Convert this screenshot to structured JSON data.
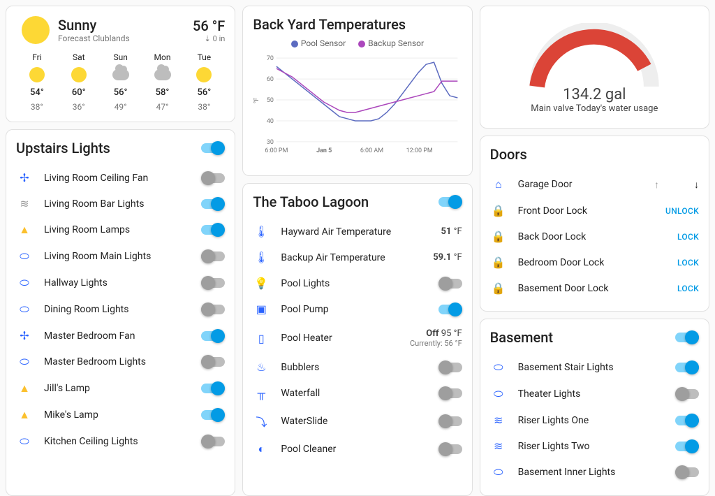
{
  "weather": {
    "condition": "Sunny",
    "location": "Forecast Clublands",
    "temp": "56 °F",
    "precip": "0 in",
    "days": [
      {
        "day": "Fri",
        "icon": "sun",
        "hi": "54°",
        "lo": "38°"
      },
      {
        "day": "Sat",
        "icon": "sun",
        "hi": "60°",
        "lo": "36°"
      },
      {
        "day": "Sun",
        "icon": "cloud",
        "hi": "56°",
        "lo": "49°"
      },
      {
        "day": "Mon",
        "icon": "cloud",
        "hi": "58°",
        "lo": "47°"
      },
      {
        "day": "Tue",
        "icon": "sun",
        "hi": "56°",
        "lo": "38°"
      }
    ]
  },
  "upstairs": {
    "title": "Upstairs Lights",
    "master": true,
    "items": [
      {
        "icon": "fan",
        "label": "Living Room Ceiling Fan",
        "on": false
      },
      {
        "icon": "bar",
        "label": "Living Room Bar Lights",
        "on": true
      },
      {
        "icon": "lamp",
        "label": "Living Room Lamps",
        "on": true
      },
      {
        "icon": "light",
        "label": "Living Room Main Lights",
        "on": false
      },
      {
        "icon": "light",
        "label": "Hallway Lights",
        "on": false
      },
      {
        "icon": "light",
        "label": "Dining Room Lights",
        "on": false
      },
      {
        "icon": "fan",
        "label": "Master Bedroom Fan",
        "on": true
      },
      {
        "icon": "light",
        "label": "Master Bedroom Lights",
        "on": false
      },
      {
        "icon": "lamp",
        "label": "Jill's Lamp",
        "on": true
      },
      {
        "icon": "lamp",
        "label": "Mike's Lamp",
        "on": true
      },
      {
        "icon": "light",
        "label": "Kitchen Ceiling Lights",
        "on": false
      }
    ]
  },
  "chart": {
    "title": "Back Yard Temperatures",
    "legend": [
      "Pool Sensor",
      "Backup Sensor"
    ],
    "ylabel": "°F",
    "xticks": [
      "6:00 PM",
      "Jan 5",
      "6:00 AM",
      "12:00 PM"
    ]
  },
  "chart_data": {
    "type": "line",
    "ylabel": "°F",
    "ylim": [
      30,
      70
    ],
    "xticks": [
      "6:00 PM",
      "Jan 5",
      "6:00 AM",
      "12:00 PM"
    ],
    "series": [
      {
        "name": "Pool Sensor",
        "color": "#5c6bc0",
        "values": [
          66,
          63,
          60,
          57,
          54,
          51,
          48,
          45,
          42,
          41,
          40,
          40,
          40,
          41,
          44,
          48,
          53,
          58,
          63,
          67,
          68,
          58,
          52,
          51
        ]
      },
      {
        "name": "Backup Sensor",
        "color": "#ab47bc",
        "values": [
          65,
          63,
          61,
          58,
          55,
          52,
          49,
          47,
          45,
          44,
          44,
          45,
          46,
          47,
          48,
          49,
          50,
          51,
          52,
          53,
          54,
          59,
          59,
          59
        ]
      }
    ]
  },
  "lagoon": {
    "title": "The Taboo Lagoon",
    "master": true,
    "items": [
      {
        "icon": "therm",
        "label": "Hayward Air Temperature",
        "value": "51 °F"
      },
      {
        "icon": "therm",
        "label": "Backup Air Temperature",
        "value": "59.1 °F"
      },
      {
        "icon": "bulb",
        "label": "Pool Lights",
        "on": false
      },
      {
        "icon": "pump",
        "label": "Pool Pump",
        "on": true
      },
      {
        "icon": "heater",
        "label": "Pool Heater",
        "value": "Off 95 °F",
        "sub": "Currently: 56 °F"
      },
      {
        "icon": "bubble",
        "label": "Bubblers",
        "on": false
      },
      {
        "icon": "waterfall",
        "label": "Waterfall",
        "on": false
      },
      {
        "icon": "slide",
        "label": "WaterSlide",
        "on": false
      },
      {
        "icon": "cleaner",
        "label": "Pool Cleaner",
        "on": false
      }
    ]
  },
  "gauge": {
    "value": "134.2 gal",
    "label": "Main valve Today's water usage"
  },
  "doors": {
    "title": "Doors",
    "items": [
      {
        "icon": "garage",
        "label": "Garage Door",
        "actions": [
          "up",
          "down"
        ]
      },
      {
        "icon": "lock",
        "label": "Front Door Lock",
        "action": "UNLOCK"
      },
      {
        "icon": "lock",
        "label": "Back Door Lock",
        "action": "LOCK"
      },
      {
        "icon": "lock",
        "label": "Bedroom Door Lock",
        "action": "LOCK"
      },
      {
        "icon": "lock",
        "label": "Basement Door Lock",
        "action": "LOCK"
      }
    ]
  },
  "basement": {
    "title": "Basement",
    "master": true,
    "items": [
      {
        "icon": "light",
        "label": "Basement Stair Lights",
        "on": true
      },
      {
        "icon": "light",
        "label": "Theater Lights",
        "on": false
      },
      {
        "icon": "riser",
        "label": "Riser Lights One",
        "on": true
      },
      {
        "icon": "riser",
        "label": "Riser Lights Two",
        "on": true
      },
      {
        "icon": "light",
        "label": "Basement Inner Lights",
        "on": false
      }
    ]
  }
}
